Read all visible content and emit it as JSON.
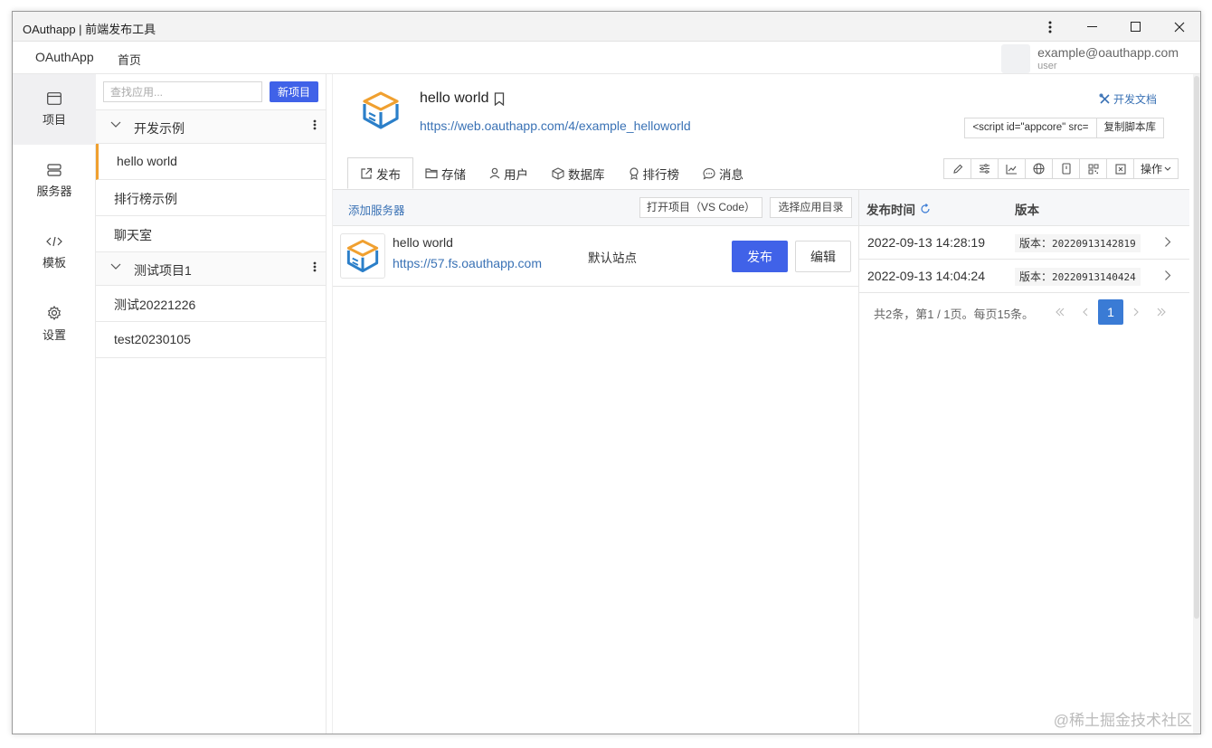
{
  "window": {
    "title": "OAuthapp | 前端发布工具"
  },
  "menubar": {
    "app": "OAuthApp",
    "home": "首页"
  },
  "user": {
    "email": "example@oauthapp.com",
    "role": "user"
  },
  "nav": [
    {
      "label": "项目",
      "icon": "window-icon"
    },
    {
      "label": "服务器",
      "icon": "server-icon"
    },
    {
      "label": "模板",
      "icon": "code-icon"
    },
    {
      "label": "设置",
      "icon": "gear-icon"
    }
  ],
  "projects": {
    "search_placeholder": "查找应用...",
    "new_label": "新项目",
    "groups": [
      {
        "name": "开发示例",
        "items": [
          "hello world",
          "排行榜示例",
          "聊天室"
        ]
      },
      {
        "name": "测试项目1",
        "items": [
          "测试20221226",
          "test20230105"
        ]
      }
    ]
  },
  "app": {
    "name": "hello world",
    "url": "https://web.oauthapp.com/4/example_helloworld",
    "devdoc": "开发文档",
    "script_code": "<script id=\"appcore\" src=",
    "copy_label": "复制脚本库"
  },
  "tabs": [
    "发布",
    "存储",
    "用户",
    "数据库",
    "排行榜",
    "消息"
  ],
  "toolbar": {
    "ops_label": "操作"
  },
  "servers": {
    "add_label": "添加服务器",
    "open_vscode": "打开项目（VS Code）",
    "select_dir": "选择应用目录",
    "items": [
      {
        "name": "hello world",
        "url": "https://57.fs.oauthapp.com",
        "site": "默认站点",
        "publish": "发布",
        "edit": "编辑"
      }
    ]
  },
  "versions": {
    "col_time": "发布时间",
    "col_version": "版本",
    "version_prefix": "版本：",
    "rows": [
      {
        "time": "2022-09-13 14:28:19",
        "version": "20220913142819"
      },
      {
        "time": "2022-09-13 14:04:24",
        "version": "20220913140424"
      }
    ],
    "pager_info": "共2条，第1 / 1页。每页15条。",
    "current_page": "1"
  },
  "watermark": "@稀土掘金技术社区",
  "colors": {
    "primary": "#4062e8",
    "link": "#3a72b5",
    "active_marker": "#f0a030",
    "logo_orange": "#f0a030",
    "logo_blue": "#2b7fc9"
  }
}
